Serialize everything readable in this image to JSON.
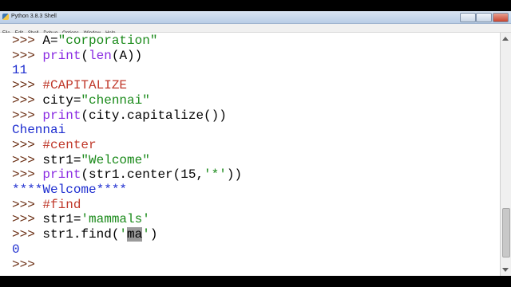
{
  "window": {
    "title": "Python 3.8.3 Shell",
    "menu": [
      "File",
      "Edit",
      "Shell",
      "Debug",
      "Options",
      "Window",
      "Help"
    ]
  },
  "shell": {
    "prompt": ">>>",
    "lines": [
      {
        "type": "input",
        "parts": [
          {
            "t": "code",
            "s": "A="
          },
          {
            "t": "str",
            "s": "\"corporation\""
          }
        ]
      },
      {
        "type": "input",
        "parts": [
          {
            "t": "kw",
            "s": "print"
          },
          {
            "t": "code",
            "s": "("
          },
          {
            "t": "kw",
            "s": "len"
          },
          {
            "t": "code",
            "s": "(A))"
          }
        ]
      },
      {
        "type": "output",
        "text": "11"
      },
      {
        "type": "input",
        "parts": [
          {
            "t": "comment",
            "s": "#CAPITALIZE"
          }
        ]
      },
      {
        "type": "input",
        "parts": [
          {
            "t": "code",
            "s": "city="
          },
          {
            "t": "str",
            "s": "\"chennai\""
          }
        ]
      },
      {
        "type": "input",
        "parts": [
          {
            "t": "kw",
            "s": "print"
          },
          {
            "t": "code",
            "s": "(city.capitalize())"
          }
        ]
      },
      {
        "type": "output",
        "text": "Chennai"
      },
      {
        "type": "input",
        "parts": [
          {
            "t": "comment",
            "s": "#center"
          }
        ]
      },
      {
        "type": "input",
        "parts": [
          {
            "t": "code",
            "s": "str1="
          },
          {
            "t": "str",
            "s": "\"Welcome\""
          }
        ]
      },
      {
        "type": "input",
        "parts": [
          {
            "t": "kw",
            "s": "print"
          },
          {
            "t": "code",
            "s": "(str1.center(15,"
          },
          {
            "t": "str",
            "s": "'*'"
          },
          {
            "t": "code",
            "s": "))"
          }
        ]
      },
      {
        "type": "output",
        "text": "****Welcome****"
      },
      {
        "type": "input",
        "parts": [
          {
            "t": "comment",
            "s": "#find"
          }
        ]
      },
      {
        "type": "input",
        "parts": [
          {
            "t": "code",
            "s": "str1="
          },
          {
            "t": "str",
            "s": "'mammals'"
          }
        ]
      },
      {
        "type": "input",
        "parts": [
          {
            "t": "code",
            "s": "str1.find("
          },
          {
            "t": "str",
            "s": "'"
          },
          {
            "t": "sel",
            "s": "ma"
          },
          {
            "t": "str",
            "s": "'"
          },
          {
            "t": "code",
            "s": ")"
          }
        ]
      },
      {
        "type": "output",
        "text": "0"
      },
      {
        "type": "prompt"
      }
    ]
  },
  "colors": {
    "prompt": "#6b2f14",
    "keyword": "#8a2be2",
    "string": "#1a8a1a",
    "comment": "#c0392b",
    "output": "#1f2fd0"
  }
}
